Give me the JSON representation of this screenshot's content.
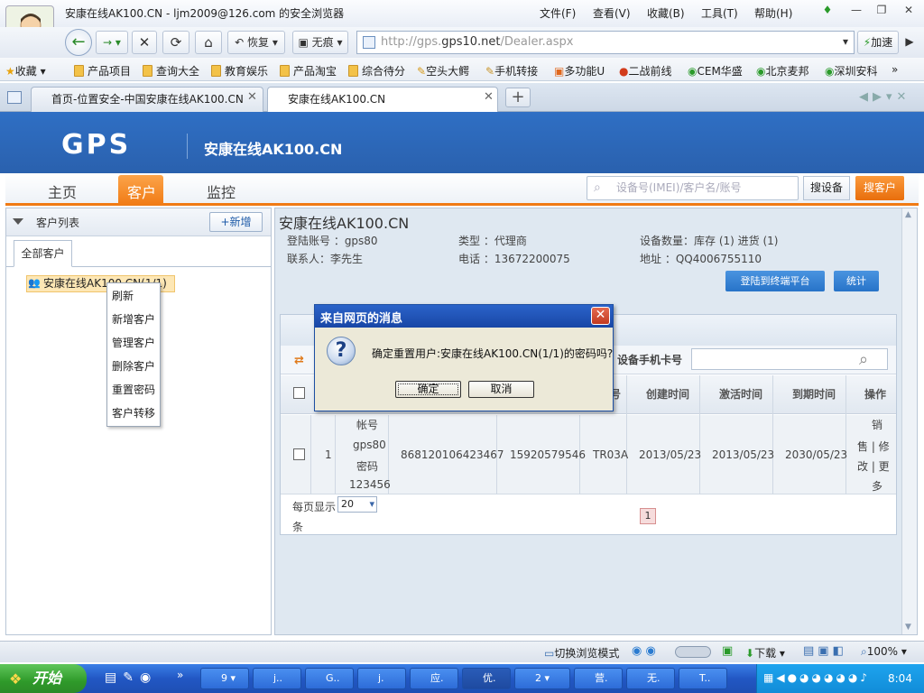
{
  "browser": {
    "window_title": "安康在线AK100.CN - ljm2009@126.com 的安全浏览器",
    "menu": [
      "文件(F)",
      "查看(V)",
      "收藏(B)",
      "工具(T)",
      "帮助(H)"
    ],
    "restore_label": "恢复",
    "traceless_label": "无痕",
    "address_prefix": "http://gps.",
    "address_domain": "gps10.net",
    "address_path": "/Dealer.aspx",
    "accelerate_label": "加速",
    "favorites_label": "收藏",
    "favorites": [
      "产品项目",
      "查询大全",
      "教育娱乐",
      "产品淘宝",
      "综合待分",
      "空头大鳄",
      "手机转接",
      "多功能U",
      "二战前线",
      "CEM华盛",
      "北京麦邦",
      "深圳安科"
    ],
    "more_favorites": "»",
    "tabs": [
      {
        "label": "首页-位置安全-中国安康在线AK100.CN"
      },
      {
        "label": "安康在线AK100.CN"
      }
    ]
  },
  "site": {
    "logo": "GPS",
    "title": "安康在线AK100.CN",
    "nav": [
      "主页",
      "客户",
      "监控"
    ],
    "search_placeholder": "设备号(IMEI)/客户名/账号",
    "search_device_label": "搜设备",
    "search_customer_label": "搜客户"
  },
  "left_panel": {
    "title": "客户列表",
    "new_button": "+新增",
    "tab_all": "全部客户",
    "tree_node": "安康在线AK100.CN(1/1)",
    "context_menu": [
      "刷新",
      "新增客户",
      "管理客户",
      "删除客户",
      "重置密码",
      "客户转移"
    ]
  },
  "dealer": {
    "name": "安康在线AK100.CN",
    "login_account": "登陆账号 ：gps80",
    "type": "类型 ：代理商",
    "device_count": "设备数量：库存 (1)  进货 (1)",
    "contact": "联系人：李先生",
    "phone": "电话 ：13672200075",
    "address": "地址 ：QQ4006755110",
    "btn_terminal": "登陆到终端平台",
    "btn_stats": "统计"
  },
  "grid": {
    "phone_label": "设备手机卡号",
    "headers": [
      "号",
      "创建时间",
      "激活时间",
      "到期时间",
      "操作"
    ],
    "row": {
      "index": "1",
      "account_label": "帐号",
      "account": "gps80",
      "password_label": "密码",
      "password": "123456",
      "imei": "868120106423467",
      "sim": "15920579546",
      "model": "TR03A",
      "created": "2013/05/23",
      "activated": "2013/05/23",
      "expires": "2030/05/23",
      "ops_1": "销",
      "ops_2": "售 | 修",
      "ops_3": "改 | 更",
      "ops_4": "多"
    },
    "per_page_label": "每页显示",
    "per_page_value": "20",
    "per_page_unit": "条",
    "page": "1"
  },
  "dialog": {
    "title": "来自网页的消息",
    "message": "确定重置用户:安康在线AK100.CN(1/1)的密码吗?",
    "ok": "确定",
    "cancel": "取消"
  },
  "statusbar": {
    "mode_label": "切换浏览模式",
    "download_label": "下载",
    "zoom": "100%"
  },
  "taskbar": {
    "start": "开始",
    "items": [
      "9",
      "j..",
      "G..",
      "j.",
      "应.",
      "优.",
      "2",
      "营.",
      "无.",
      "T.."
    ],
    "clock": "8:04"
  }
}
